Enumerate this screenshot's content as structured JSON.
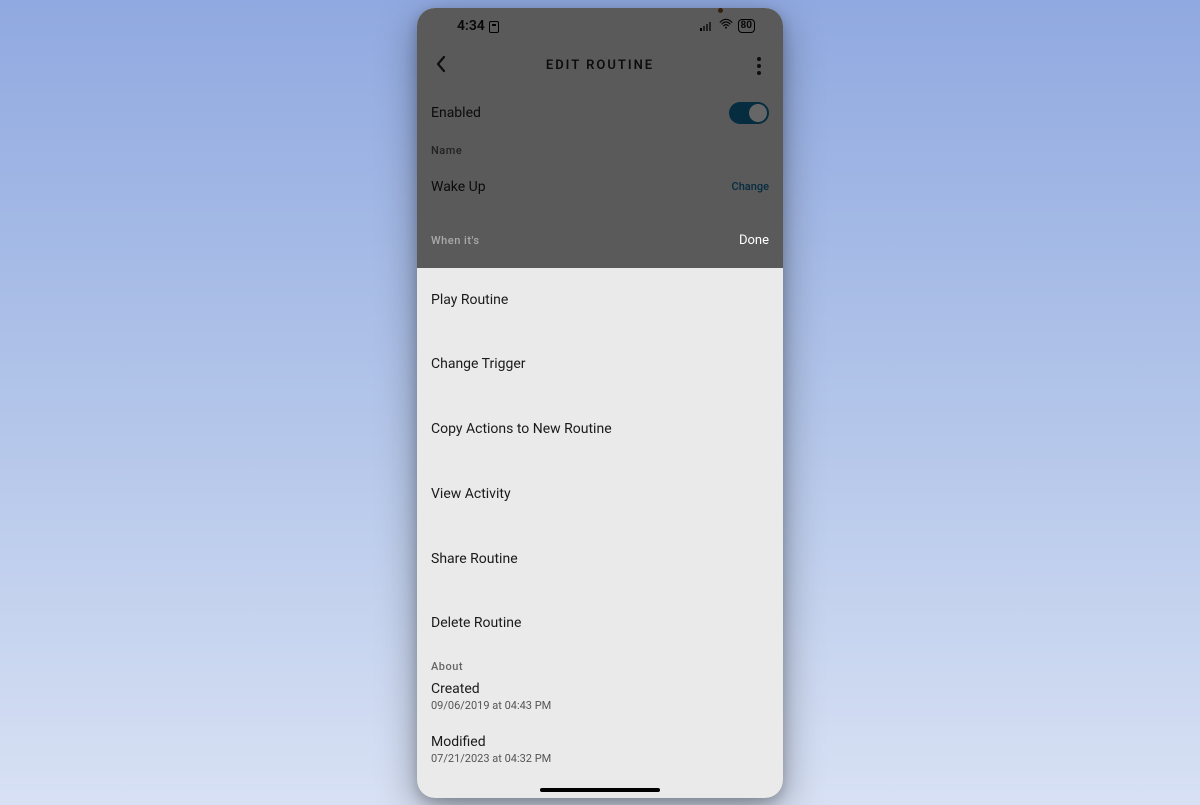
{
  "statusbar": {
    "time": "4:34",
    "battery": "80"
  },
  "header": {
    "title": "EDIT ROUTINE"
  },
  "settings": {
    "enabled_label": "Enabled",
    "name_label": "Name",
    "routine_name": "Wake Up",
    "change_label": "Change",
    "when_label": "When it's"
  },
  "sheet": {
    "done_label": "Done",
    "items": [
      "Play Routine",
      "Change Trigger",
      "Copy Actions to New Routine",
      "View Activity",
      "Share Routine",
      "Delete Routine"
    ],
    "about_label": "About",
    "created_label": "Created",
    "created_value": "09/06/2019 at 04:43 PM",
    "modified_label": "Modified",
    "modified_value": "07/21/2023 at 04:32 PM"
  }
}
